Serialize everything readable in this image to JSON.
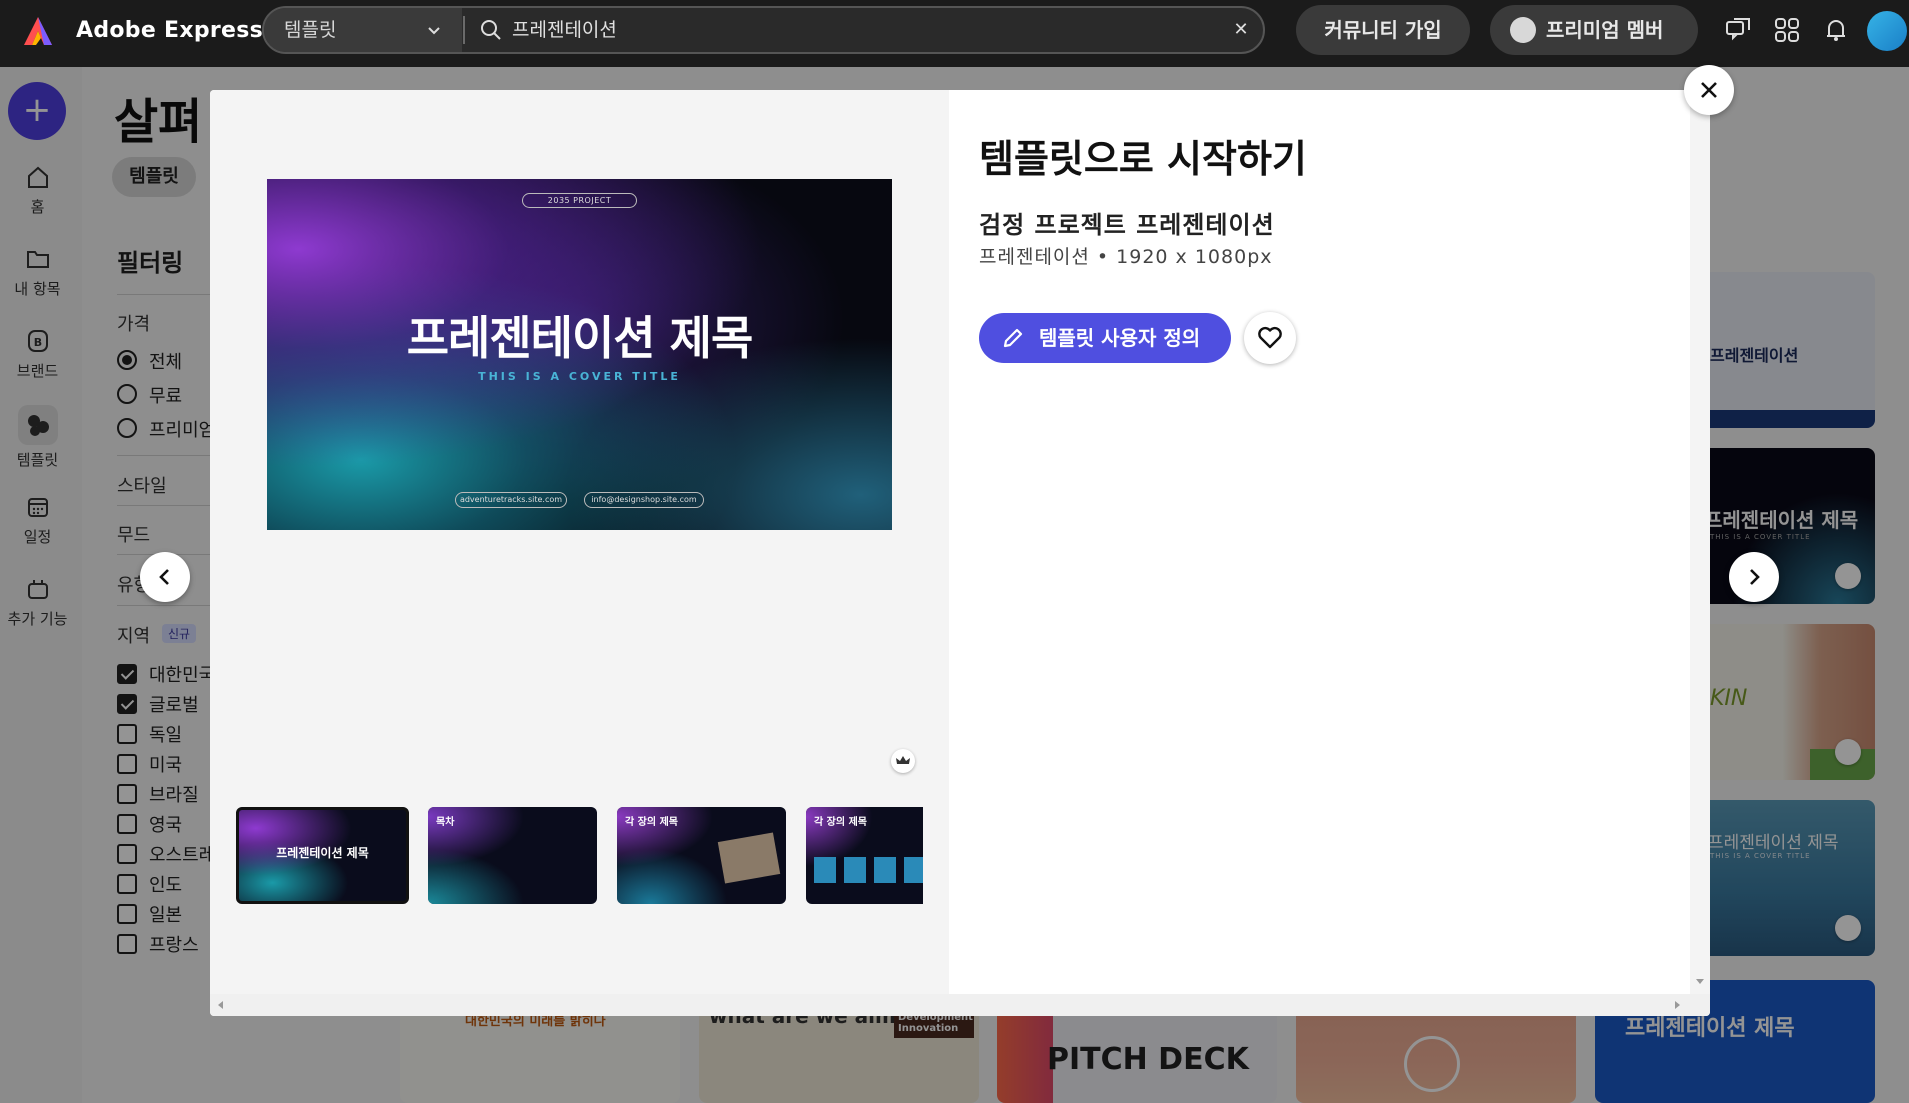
{
  "app": {
    "name": "Adobe Express"
  },
  "search": {
    "category": "템플릿",
    "query": "프레젠테이션"
  },
  "header": {
    "community_label": "커뮤니티 가입",
    "premium_label": "프리미엄 멤버"
  },
  "rail": {
    "items": [
      {
        "label": "홈",
        "icon": "home-icon"
      },
      {
        "label": "내 항목",
        "icon": "folder-icon"
      },
      {
        "label": "브랜드",
        "icon": "brand-icon"
      },
      {
        "label": "템플릿",
        "icon": "templates-icon"
      },
      {
        "label": "일정",
        "icon": "calendar-icon"
      },
      {
        "label": "추가 기능",
        "icon": "addons-icon"
      }
    ]
  },
  "page": {
    "title": "살펴",
    "chip": "템플릿",
    "filter_title": "필터링",
    "price_label": "가격",
    "price_options": [
      "전체",
      "무료",
      "프리미엄"
    ],
    "style_label": "스타일",
    "mood_label": "무드",
    "type_label": "유형",
    "region_label": "지역",
    "region_badge": "신규",
    "regions": [
      "대한민국",
      "글로벌",
      "독일",
      "미국",
      "브라질",
      "영국",
      "오스트레일리아",
      "인도",
      "일본",
      "프랑스"
    ]
  },
  "background_cards": {
    "right_top": "프레젠테이션",
    "right_mid": "프레젠테이션 제목",
    "right_mid_sub": "THIS IS A COVER TITLE",
    "right_skin": "KIN",
    "right_blue": "프레젠테이션 제목",
    "right_blue_sub": "THIS IS A COVER TITLE",
    "bottom_korea": "대한민국의 미래를 밝히다",
    "bottom_what": "what are we aiming for",
    "bottom_dev": "Development Innovation",
    "bottom_pitch": "PITCH DECK",
    "bottom_last": "프레젠테이션 제목"
  },
  "modal": {
    "heading": "템플릿으로 시작하기",
    "template_name": "검정 프로젝트 프레젠테이션",
    "template_meta": "프레젠테이션 • 1920 x 1080px",
    "customize_label": "템플릿 사용자 정의",
    "hero": {
      "project_tag": "2035 PROJECT",
      "title": "프레젠테이션 제목",
      "subtitle": "THIS IS A COVER TITLE",
      "link1": "adventuretracks.site.com",
      "link2": "info@designshop.site.com"
    },
    "thumbnails": [
      {
        "title": "프레젠테이션 제목"
      },
      {
        "title": "목차"
      },
      {
        "title": "각 장의 제목"
      },
      {
        "title": "각 장의 제목"
      }
    ]
  }
}
